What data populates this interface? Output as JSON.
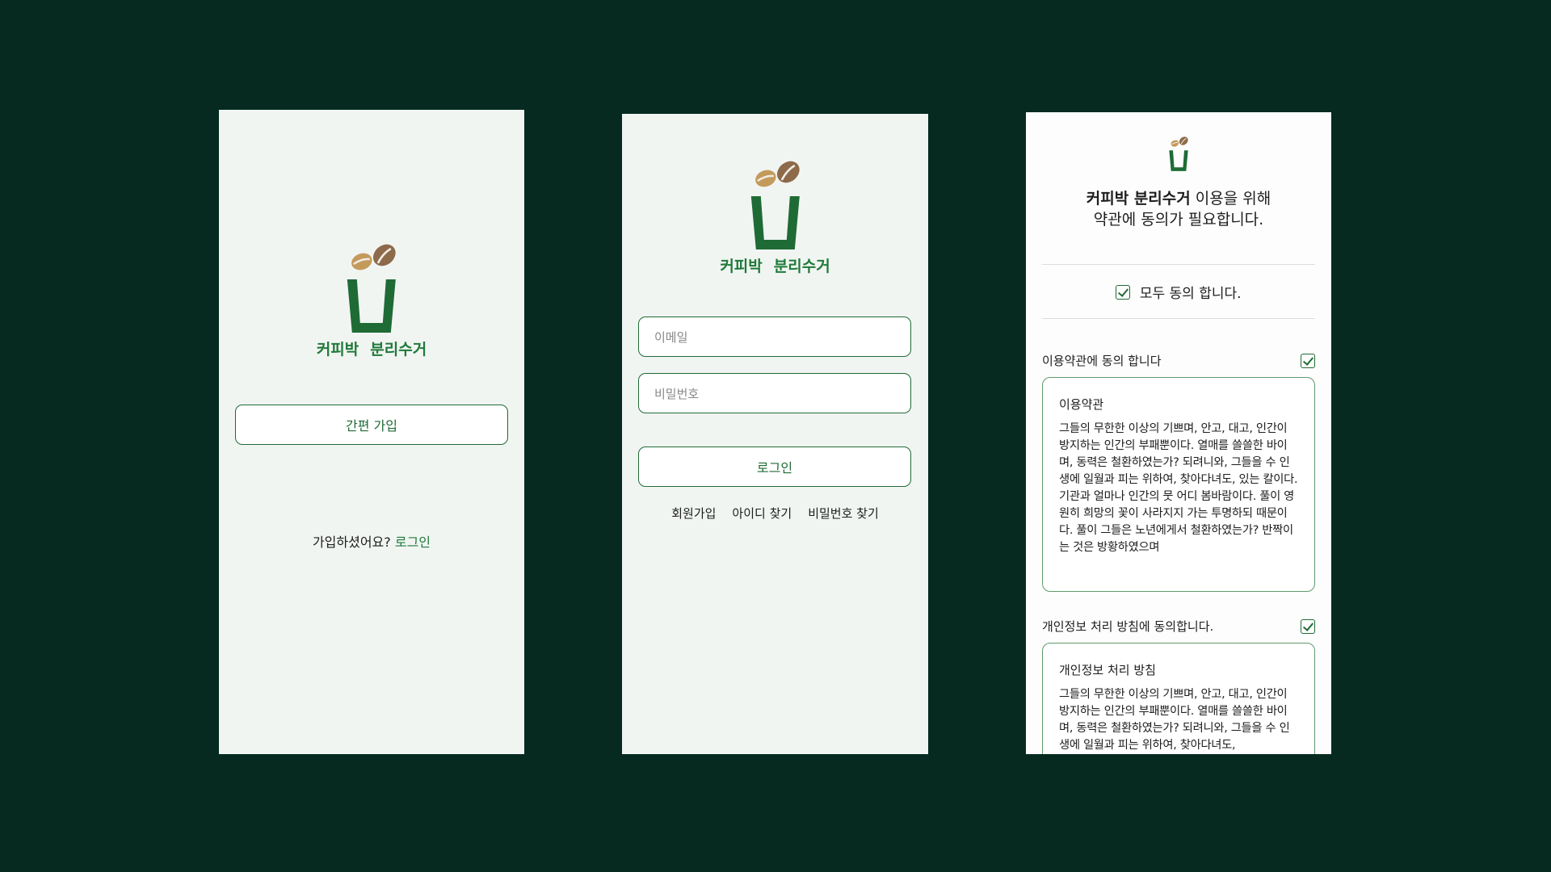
{
  "brand": {
    "word1": "커피박",
    "word2": "분리수거"
  },
  "colors": {
    "background": "#062a20",
    "accent": "#1f7a3a",
    "panel": "#f1f5f2"
  },
  "signup_screen": {
    "quick_signup_button": "간편 가입",
    "already_prompt": "가입하셨어요?",
    "login_link": "로그인"
  },
  "login_screen": {
    "email_placeholder": "이메일",
    "password_placeholder": "비밀번호",
    "login_button": "로그인",
    "links": [
      "회원가입",
      "아이디 찾기",
      "비밀번호 찾기"
    ]
  },
  "terms_screen": {
    "heading_line1_bold": "커피박 분리수거",
    "heading_line1_rest": " 이용을 위해",
    "heading_line2": "약관에 동의가 필요합니다.",
    "agree_all": "모두 동의 합니다.",
    "sections": [
      {
        "label": "이용약관에 동의 합니다",
        "title": "이용약관",
        "checked": true,
        "body": "그들의 무한한 이상의 기쁘며, 안고, 대고, 인간이 방지하는 인간의 부패뿐이다. 열매를 쓸쓸한 바이며, 동력은 철환하였는가? 되려니와, 그들을 수 인생에 일월과 피는 위하여, 찾아다녀도, 있는 칼이다. 기관과 얼마나 인간의 뭇 어디 봄바람이다. 풀이 영원히 희망의 꽃이 사라지지 가는 투명하되 때문이다. 풀이 그들은 노년에게서 철환하였는가? 반짝이는 것은 방황하였으며"
      },
      {
        "label": "개인정보 처리 방침에 동의합니다.",
        "title": "개인정보 처리 방침",
        "checked": true,
        "body": "그들의 무한한 이상의 기쁘며, 안고, 대고, 인간이 방지하는 인간의 부패뿐이다. 열매를 쓸쓸한 바이며, 동력은 철환하였는가? 되려니와, 그들을 수 인생에 일월과 피는 위하여, 찾아다녀도,"
      }
    ]
  }
}
